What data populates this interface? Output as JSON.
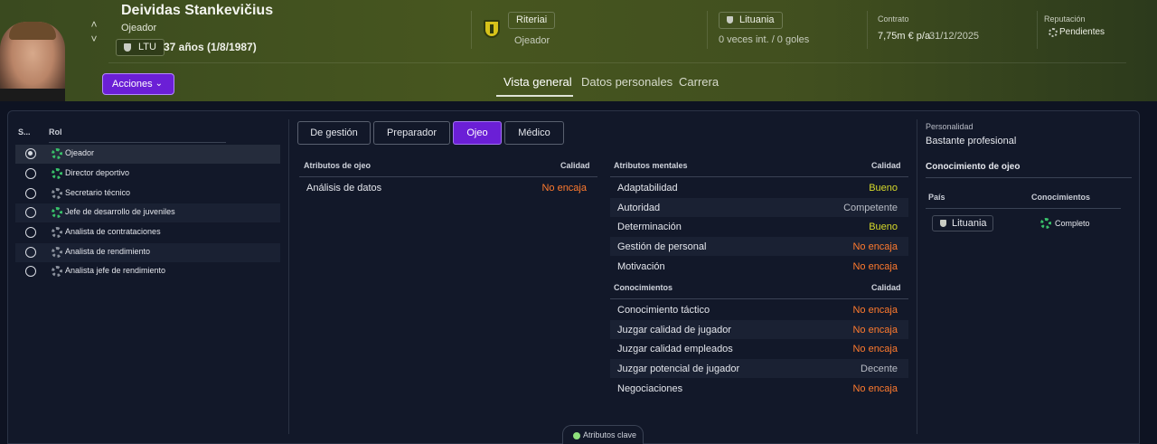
{
  "header": {
    "player_name": "Deividas Stankevičius",
    "player_role": "Ojeador",
    "nationality_code": "LTU",
    "age": "37 años (1/8/1987)",
    "actions_label": "Acciones",
    "club_name": "Riteriai",
    "club_role": "Ojeador",
    "country": "Lituania",
    "caps_goals": "0 veces int. / 0 goles",
    "contract_label": "Contrato",
    "contract_wage": "7,75m € p/a",
    "contract_end": "31/12/2025",
    "reputation_label": "Reputación",
    "reputation_value": "Pendientes"
  },
  "tabs": [
    "Vista general",
    "Datos personales",
    "Carrera"
  ],
  "active_tab": "Vista general",
  "roles": {
    "col_selected": "S...",
    "col_role": "Rol",
    "items": [
      {
        "label": "Ojeador",
        "selected": true,
        "icon": "green"
      },
      {
        "label": "Director deportivo",
        "selected": false,
        "icon": "green"
      },
      {
        "label": "Secretario técnico",
        "selected": false,
        "icon": "grey"
      },
      {
        "label": "Jefe de desarrollo de juveniles",
        "selected": false,
        "icon": "green"
      },
      {
        "label": "Analista de contrataciones",
        "selected": false,
        "icon": "grey"
      },
      {
        "label": "Analista de rendimiento",
        "selected": false,
        "icon": "grey"
      },
      {
        "label": "Analista jefe de rendimiento",
        "selected": false,
        "icon": "grey"
      }
    ]
  },
  "segments": [
    "De gestión",
    "Preparador",
    "Ojeo",
    "Médico"
  ],
  "active_segment": "Ojeo",
  "scout_attrs": {
    "title": "Atributos de ojeo",
    "quality_header": "Calidad",
    "rows": [
      {
        "name": "Análisis de datos",
        "quality": "No encaja"
      }
    ]
  },
  "mental_attrs": {
    "title": "Atributos mentales",
    "quality_header": "Calidad",
    "rows": [
      {
        "name": "Adaptabilidad",
        "quality": "Bueno"
      },
      {
        "name": "Autoridad",
        "quality": "Competente"
      },
      {
        "name": "Determinación",
        "quality": "Bueno"
      },
      {
        "name": "Gestión de personal",
        "quality": "No encaja"
      },
      {
        "name": "Motivación",
        "quality": "No encaja"
      }
    ]
  },
  "knowledge_attrs": {
    "title": "Conocimientos",
    "quality_header": "Calidad",
    "rows": [
      {
        "name": "Conocimiento táctico",
        "quality": "No encaja"
      },
      {
        "name": "Juzgar calidad de jugador",
        "quality": "No encaja"
      },
      {
        "name": "Juzgar calidad empleados",
        "quality": "No encaja"
      },
      {
        "name": "Juzgar potencial de jugador",
        "quality": "Decente"
      },
      {
        "name": "Negociaciones",
        "quality": "No encaja"
      }
    ]
  },
  "personality": {
    "label": "Personalidad",
    "value": "Bastante profesional"
  },
  "scout_knowledge": {
    "title": "Conocimiento de ojeo",
    "col_country": "País",
    "col_knowledge": "Conocimientos",
    "country": "Lituania",
    "knowledge": "Completo"
  },
  "key_attributes_label": "Atributos clave",
  "colors": {
    "accent": "#6b1fd6",
    "bad": "#ff7a2e",
    "good": "#d6d92a",
    "neutral": "#b9bdc6",
    "green_icon": "#39c06a"
  }
}
